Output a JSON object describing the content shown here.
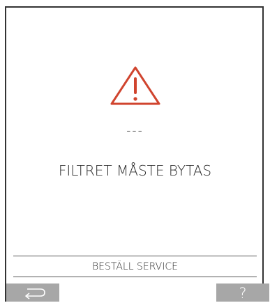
{
  "screen": {
    "status_dashes": "---",
    "message": "FILTRET MÅSTE BYTAS",
    "footer_label": "BESTÄLL SERVICE"
  },
  "icons": {
    "warning": "warning-triangle-icon",
    "back": "back-arrow-icon",
    "help": "question-mark-icon"
  },
  "softkeys": {
    "help_glyph": "?"
  },
  "colors": {
    "warning": "#d0442e",
    "softkey_bg": "#a7a7a7",
    "softkey_fg": "#ffffff",
    "frame": "#333333",
    "text": "#2b2b2b"
  }
}
